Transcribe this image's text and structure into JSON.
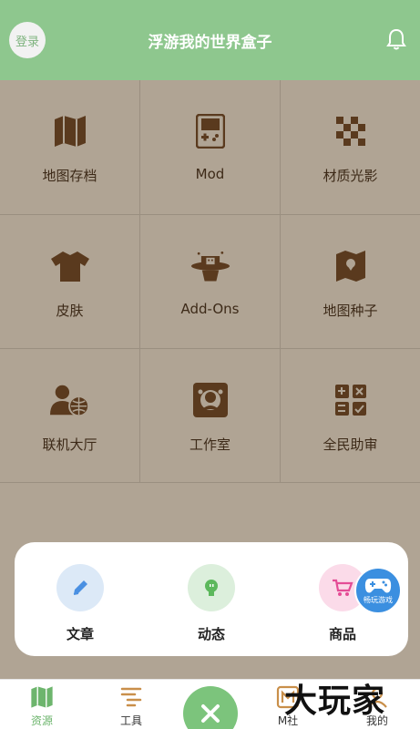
{
  "header": {
    "login_label": "登录",
    "title": "浮游我的世界盒子",
    "bell_icon": "bell-icon"
  },
  "grid": {
    "items": [
      {
        "label": "地图存档",
        "icon": "map-icon"
      },
      {
        "label": "Mod",
        "icon": "gameboy-icon"
      },
      {
        "label": "材质光影",
        "icon": "checker-icon"
      },
      {
        "label": "皮肤",
        "icon": "shirt-icon"
      },
      {
        "label": "Add-Ons",
        "icon": "magic-hat-icon"
      },
      {
        "label": "地图种子",
        "icon": "map-seed-icon"
      },
      {
        "label": "联机大厅",
        "icon": "multiplayer-icon"
      },
      {
        "label": "工作室",
        "icon": "studio-icon"
      },
      {
        "label": "全民助审",
        "icon": "review-icon"
      }
    ]
  },
  "quick_card": {
    "items": [
      {
        "label": "文章",
        "icon": "pencil-icon",
        "color": "#4a90e2"
      },
      {
        "label": "动态",
        "icon": "bulb-icon",
        "color": "#5cb85c"
      },
      {
        "label": "商品",
        "icon": "cart-icon",
        "color": "#e44d96"
      }
    ]
  },
  "float_game": {
    "label": "畅玩游戏"
  },
  "tabbar": {
    "tabs": [
      {
        "label": "资源",
        "icon": "map-icon",
        "active": true
      },
      {
        "label": "工具",
        "icon": "tools-icon",
        "active": false
      },
      {
        "label": "M社",
        "icon": "m-community-icon",
        "active": false
      },
      {
        "label": "我的",
        "icon": "profile-icon",
        "active": false
      }
    ]
  },
  "watermark": {
    "text": "大玩家"
  },
  "colors": {
    "header": "#8ec78e",
    "grid_bg": "#b0a494",
    "icon": "#5a3a1e",
    "accent": "#6db56d"
  }
}
